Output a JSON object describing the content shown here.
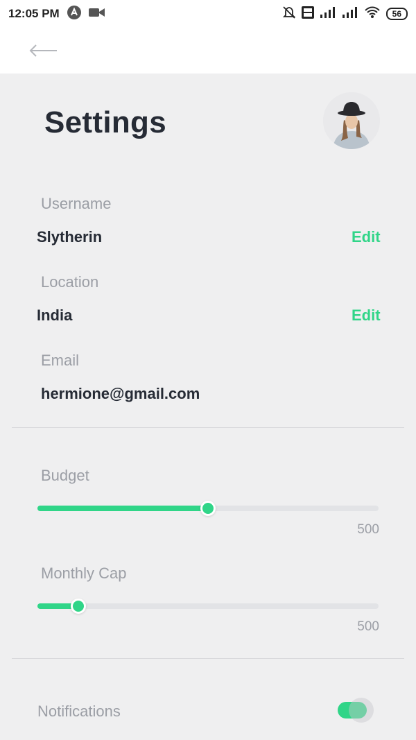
{
  "status_bar": {
    "time": "12:05 PM",
    "battery": "56"
  },
  "page": {
    "title": "Settings"
  },
  "profile": {
    "username_label": "Username",
    "username_value": "Slytherin",
    "location_label": "Location",
    "location_value": "India",
    "email_label": "Email",
    "email_value": "hermione@gmail.com",
    "edit_label": "Edit"
  },
  "budget": {
    "label": "Budget",
    "value_fraction": 0.5,
    "max_label": "500"
  },
  "monthly_cap": {
    "label": "Monthly Cap",
    "value_fraction": 0.12,
    "max_label": "500"
  },
  "notifications": {
    "label": "Notifications",
    "enabled": true
  },
  "colors": {
    "accent": "#30d588",
    "background": "#efeff0",
    "text_dark": "#262b35",
    "text_muted": "#9b9ea5"
  }
}
